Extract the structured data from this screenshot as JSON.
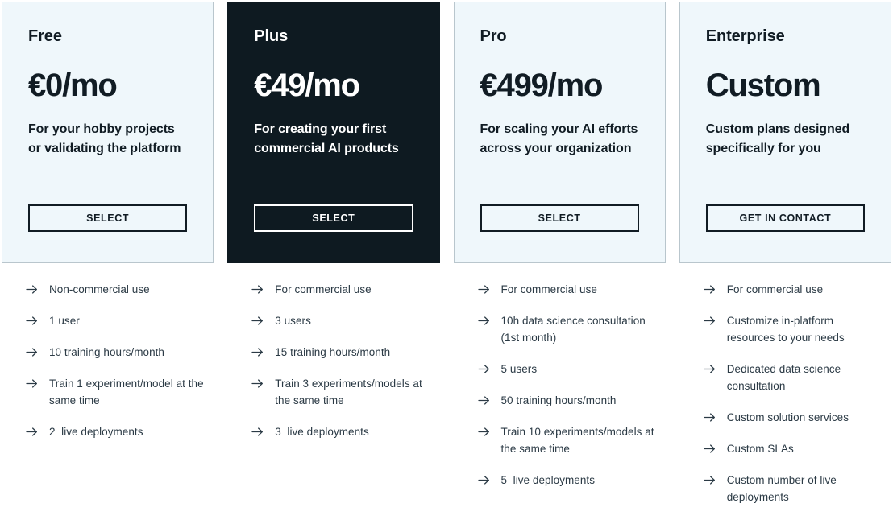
{
  "colors": {
    "card_light_bg": "#eff7fb",
    "card_dark_bg": "#0e1a21",
    "card_border": "#b9c6cd",
    "text_dark": "#111c24",
    "text_feature": "#2b3a45",
    "text_light": "#ffffff",
    "page_bg": "#ffffff"
  },
  "icons": {
    "feature_bullet": "arrow-right-icon"
  },
  "plans": [
    {
      "id": "free",
      "name": "Free",
      "price": "€0/mo",
      "description": "For your hobby projects or validating the platform",
      "cta_label": "SELECT",
      "theme": "light",
      "features": [
        "Non-commercial use",
        "1 user",
        "10 training hours/month",
        "Train 1 experiment/model at the same time",
        "2  live deployments"
      ]
    },
    {
      "id": "plus",
      "name": "Plus",
      "price": "€49/mo",
      "description": "For creating your first commercial AI products",
      "cta_label": "SELECT",
      "theme": "dark",
      "features": [
        "For commercial use",
        "3 users",
        "15 training hours/month",
        "Train 3 experiments/models at the same time",
        "3  live deployments"
      ]
    },
    {
      "id": "pro",
      "name": "Pro",
      "price": "€499/mo",
      "description": "For scaling your AI efforts across your organization",
      "cta_label": "SELECT",
      "theme": "light",
      "features": [
        "For commercial use",
        "10h data science consultation (1st month)",
        "5 users",
        "50 training hours/month",
        "Train 10 experiments/models at the same time",
        "5  live deployments"
      ]
    },
    {
      "id": "enterprise",
      "name": "Enterprise",
      "price": "Custom",
      "description": "Custom plans designed specifically for you",
      "cta_label": "GET IN CONTACT",
      "theme": "light",
      "features": [
        "For commercial use",
        "Customize in-platform resources to your needs",
        "Dedicated data science consultation",
        "Custom solution services",
        "Custom SLAs",
        "Custom number of live deployments"
      ]
    }
  ]
}
